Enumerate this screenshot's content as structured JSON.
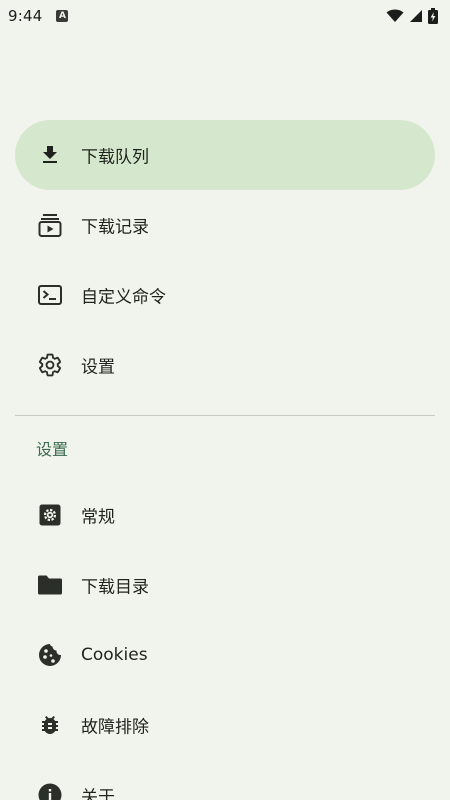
{
  "status_bar": {
    "time": "9:44",
    "notification_icon": "a-badge-icon",
    "indicators": [
      "wifi-icon",
      "signal-icon",
      "battery-charging-icon"
    ]
  },
  "drawer": {
    "primary_items": [
      {
        "label": "下载队列",
        "icon": "download-icon",
        "active": true
      },
      {
        "label": "下载记录",
        "icon": "history-icon",
        "active": false
      },
      {
        "label": "自定义命令",
        "icon": "terminal-icon",
        "active": false
      },
      {
        "label": "设置",
        "icon": "gear-icon",
        "active": false
      }
    ],
    "section_header": "设置",
    "settings_items": [
      {
        "label": "常规",
        "icon": "settings-box-icon"
      },
      {
        "label": "下载目录",
        "icon": "folder-icon"
      },
      {
        "label": "Cookies",
        "icon": "cookie-icon"
      },
      {
        "label": "故障排除",
        "icon": "bug-icon"
      },
      {
        "label": "关于",
        "icon": "info-icon"
      }
    ]
  },
  "colors": {
    "background": "#f1f4ec",
    "active_item": "#d5e8cd",
    "section_header": "#3c6b4f",
    "text": "#1f231d"
  }
}
